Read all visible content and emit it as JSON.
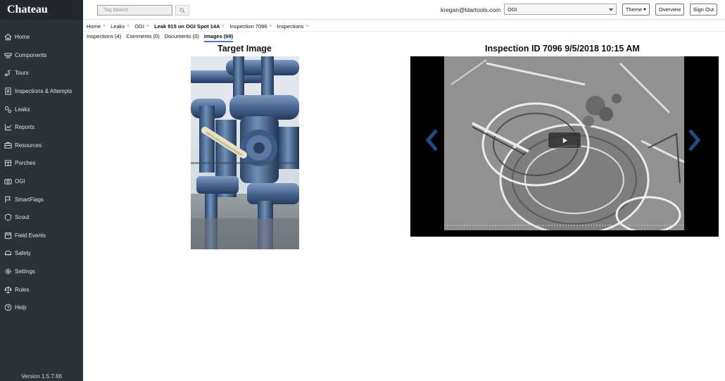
{
  "app": {
    "logo": "Chateau",
    "version": "Version 1.5.7.66"
  },
  "sidebar": {
    "items": [
      {
        "label": "Home",
        "icon": "home-icon"
      },
      {
        "label": "Components",
        "icon": "components-icon"
      },
      {
        "label": "Tours",
        "icon": "tours-icon"
      },
      {
        "label": "Inspections & Attempts",
        "icon": "inspections-icon"
      },
      {
        "label": "Leaks",
        "icon": "leaks-icon"
      },
      {
        "label": "Reports",
        "icon": "reports-icon"
      },
      {
        "label": "Resources",
        "icon": "resources-icon"
      },
      {
        "label": "Porches",
        "icon": "porches-icon"
      },
      {
        "label": "OGI",
        "icon": "camera-icon"
      },
      {
        "label": "SmartFlags",
        "icon": "flag-icon"
      },
      {
        "label": "Scout",
        "icon": "scout-icon"
      },
      {
        "label": "Field Events",
        "icon": "field-events-icon"
      },
      {
        "label": "Safety",
        "icon": "safety-icon"
      },
      {
        "label": "Settings",
        "icon": "gear-icon"
      },
      {
        "label": "Rules",
        "icon": "rules-icon"
      },
      {
        "label": "Help",
        "icon": "help-icon"
      }
    ]
  },
  "header": {
    "search_placeholder": "Tag Search",
    "user_email": "kregan@ldartools.com",
    "program_select": "OGI",
    "theme_label": "Theme",
    "overview_label": "Overview",
    "signout_label": "Sign Out"
  },
  "breadcrumbs": [
    {
      "label": "Home",
      "close": "×"
    },
    {
      "label": "Leaks",
      "close": "×"
    },
    {
      "label": "OGI",
      "close": "×"
    },
    {
      "label": "Leak 915 on OGI Spot 14A",
      "close": "×",
      "active": true
    },
    {
      "label": "Inspection 7096",
      "close": "×"
    },
    {
      "label": "Inspections",
      "close": "×"
    }
  ],
  "subtabs": [
    {
      "label": "Inspections (4)"
    },
    {
      "label": "Comments (0)"
    },
    {
      "label": "Documents (0)"
    },
    {
      "label": "Images (69)",
      "active": true
    }
  ],
  "main": {
    "target_title": "Target Image",
    "inspection_title": "Inspection ID 7096 9/5/2018 10:15 AM"
  },
  "colors": {
    "sidebar_bg": "#2b323a",
    "accent": "#4a78c4",
    "carousel_arrow": "#1d4f86"
  }
}
